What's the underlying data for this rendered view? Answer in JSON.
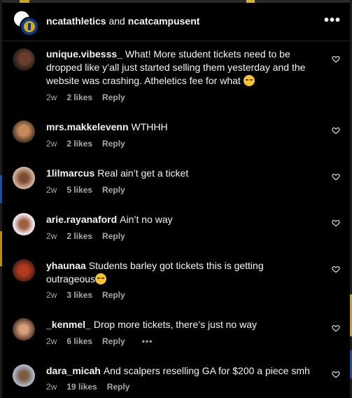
{
  "header": {
    "account_primary": "ncatathletics",
    "joiner": "and",
    "account_secondary": "ncatcampusent",
    "more_label": "•••"
  },
  "comments": [
    {
      "username": "unique.vibesss_",
      "text": "What! More student tickets need to be dropped like y’all just started selling them yesterday and the website was crashing. Atheletics fee for what",
      "emoji": "crying-face",
      "time": "2w",
      "likes": "2 likes",
      "reply": "Reply"
    },
    {
      "username": "mrs.makkelevenn",
      "text": "WTHHH",
      "time": "2w",
      "likes": "2 likes",
      "reply": "Reply"
    },
    {
      "username": "1lilmarcus",
      "text": "Real ain’t get a ticket",
      "time": "2w",
      "likes": "5 likes",
      "reply": "Reply"
    },
    {
      "username": "arie.rayanaford",
      "text": "Ain’t no way",
      "time": "2w",
      "likes": "2 likes",
      "reply": "Reply"
    },
    {
      "username": "yhaunaa",
      "text": "Students barley got tickets this is getting outrageous",
      "emoji": "crying-face",
      "time": "2w",
      "likes": "3 likes",
      "reply": "Reply"
    },
    {
      "username": "_kenmel_",
      "text": "Drop more tickets, there’s just no way",
      "time": "2w",
      "likes": "6 likes",
      "reply": "Reply",
      "more": "•••"
    },
    {
      "username": "dara_micah",
      "text": "And scalpers reselling GA for $200 a piece smh",
      "time": "2w",
      "likes": "19 likes",
      "reply": "Reply"
    }
  ],
  "colors": {
    "background": "#000000",
    "text": "#f5f5f5",
    "meta": "#a8a8a8",
    "divider": "#262626"
  }
}
